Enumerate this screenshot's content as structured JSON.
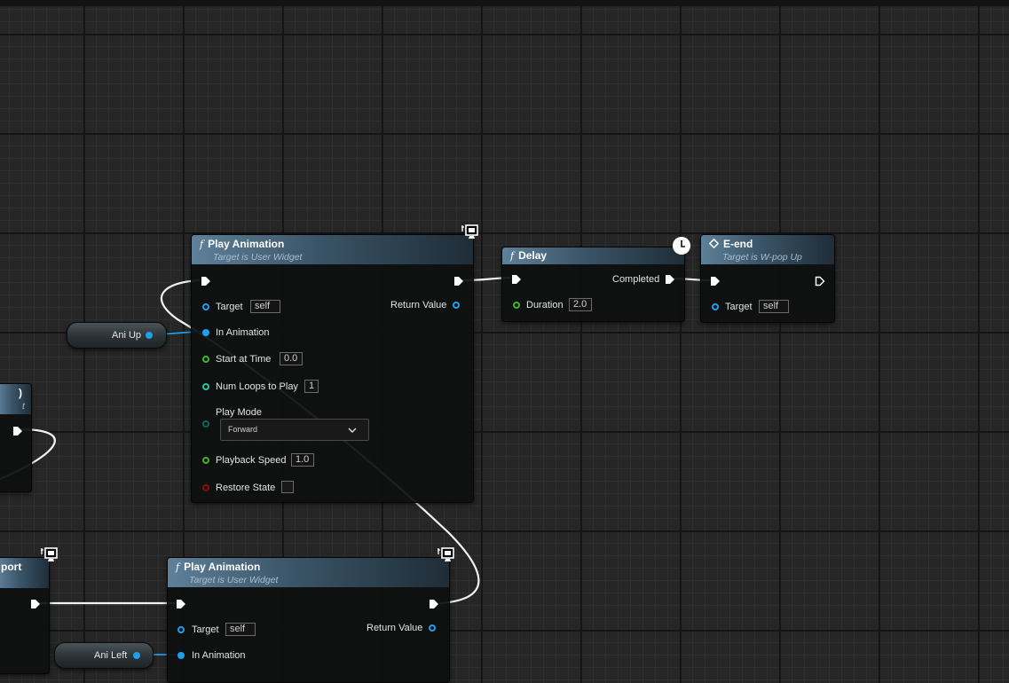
{
  "nodes": {
    "play1": {
      "title": "Play Animation",
      "subtitle": "Target is User Widget",
      "target_label": "Target",
      "target_value": "self",
      "return_label": "Return Value",
      "in_anim_label": "In Animation",
      "start_label": "Start at Time",
      "start_value": "0.0",
      "loops_label": "Num Loops to Play",
      "loops_value": "1",
      "mode_label": "Play Mode",
      "mode_value": "Forward",
      "speed_label": "Playback Speed",
      "speed_value": "1.0",
      "restore_label": "Restore State"
    },
    "delay": {
      "title": "Delay",
      "completed_label": "Completed",
      "duration_label": "Duration",
      "duration_value": "2.0"
    },
    "eend": {
      "title": "E-end",
      "subtitle": "Target is W-pop Up",
      "target_label": "Target",
      "target_value": "self"
    },
    "play2": {
      "title": "Play Animation",
      "subtitle": "Target is User Widget",
      "target_label": "Target",
      "target_value": "self",
      "return_label": "Return Value",
      "in_anim_label": "In Animation"
    },
    "left_mid": {
      "title_fragment": ")",
      "subtitle_fragment": "t"
    },
    "left_bottom": {
      "title_fragment": "port"
    }
  },
  "variables": {
    "ani_up": "Ani Up",
    "ani_left": "Ani Left"
  },
  "colors": {
    "object_pin": "#1ea0ea",
    "float_pin": "#3eb52a",
    "int_pin": "#1fc89a",
    "enum_pin": "#0b6656",
    "bool_pin": "#8c0f0f",
    "exec_wire": "#ffffff",
    "header_blue": "#4d6f88"
  },
  "icons": {
    "function": "f-function-icon",
    "widget": "monitor-widget-icon",
    "latent": "clock-icon",
    "event": "diamond-event-icon"
  }
}
